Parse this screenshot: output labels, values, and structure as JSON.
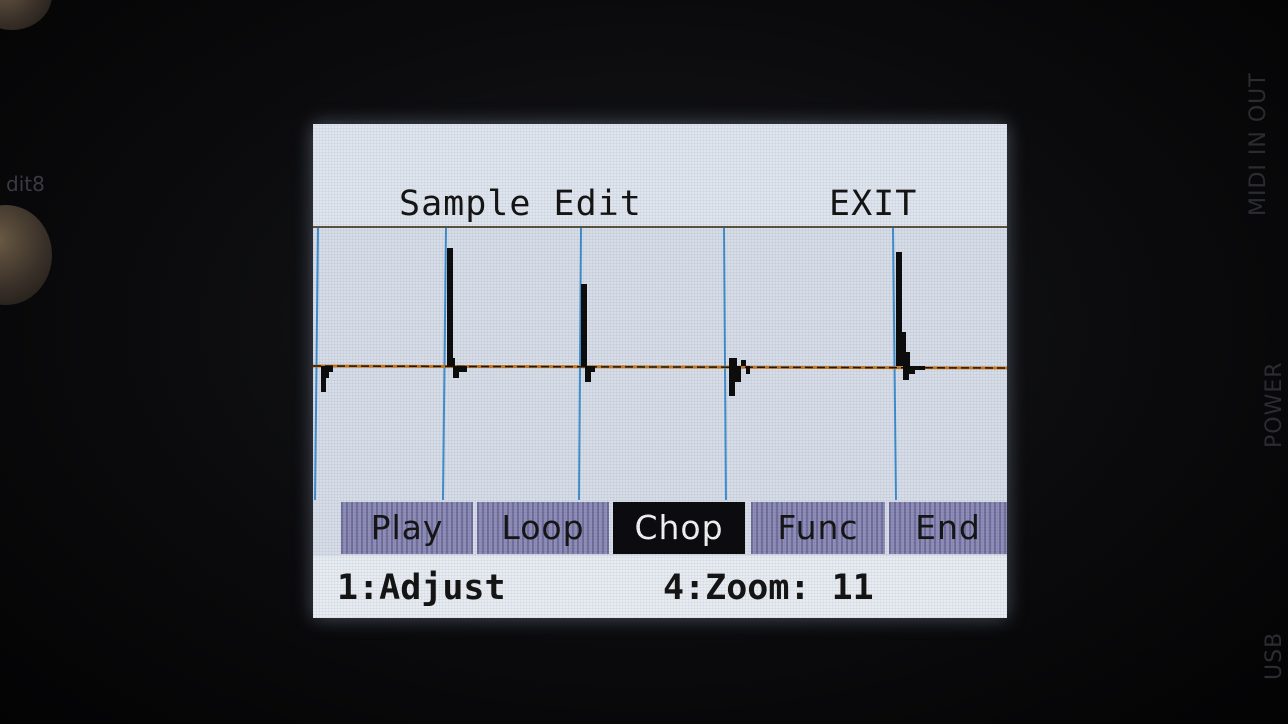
{
  "device": {
    "side_labels": {
      "midi": "MIDI IN OUT",
      "power": "POWER",
      "usb": "USB"
    },
    "knob_label": "dit8"
  },
  "screen": {
    "title": "Sample Edit",
    "exit_label": "EXIT",
    "tabs": [
      {
        "label": "Play",
        "active": false
      },
      {
        "label": "Loop",
        "active": false
      },
      {
        "label": "Chop",
        "active": true
      },
      {
        "label": "Func",
        "active": false
      },
      {
        "label": "End",
        "active": false
      }
    ],
    "footer": {
      "left": "1:Adjust",
      "right": "4:Zoom: 11"
    },
    "waveform": {
      "chop_marker_count": 5,
      "colors": {
        "marker": "#3f8fd0",
        "baseline": "#c8781e",
        "wave": "#0d0d0d"
      }
    }
  }
}
